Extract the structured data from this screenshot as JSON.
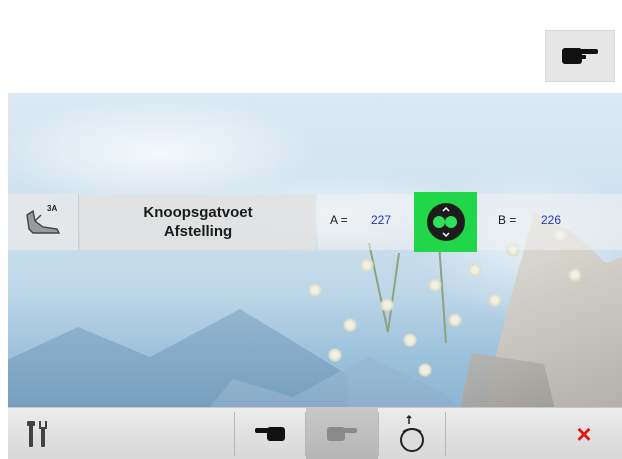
{
  "header": {
    "pointer_icon": "pointing-hand-icon"
  },
  "info_bar": {
    "foot_icon": "buttonhole-foot-icon",
    "foot_code": "3A",
    "title_line1": "Knoopsgatvoet",
    "title_line2": "Afstelling",
    "a_label": "A =",
    "a_value": "227",
    "b_label": "B =",
    "b_value": "226",
    "adjust_icon": "adjust-knob-icon"
  },
  "toolbar": {
    "settings_icon": "wrench-screwdriver-icon",
    "pointer_left_icon": "hand-left-icon",
    "pointer_right_icon": "hand-right-icon",
    "knob_icon": "stitch-knob-icon",
    "close_icon": "close-icon",
    "close_label": "×",
    "close_color": "#e01818",
    "accent_green": "#22d64a"
  }
}
